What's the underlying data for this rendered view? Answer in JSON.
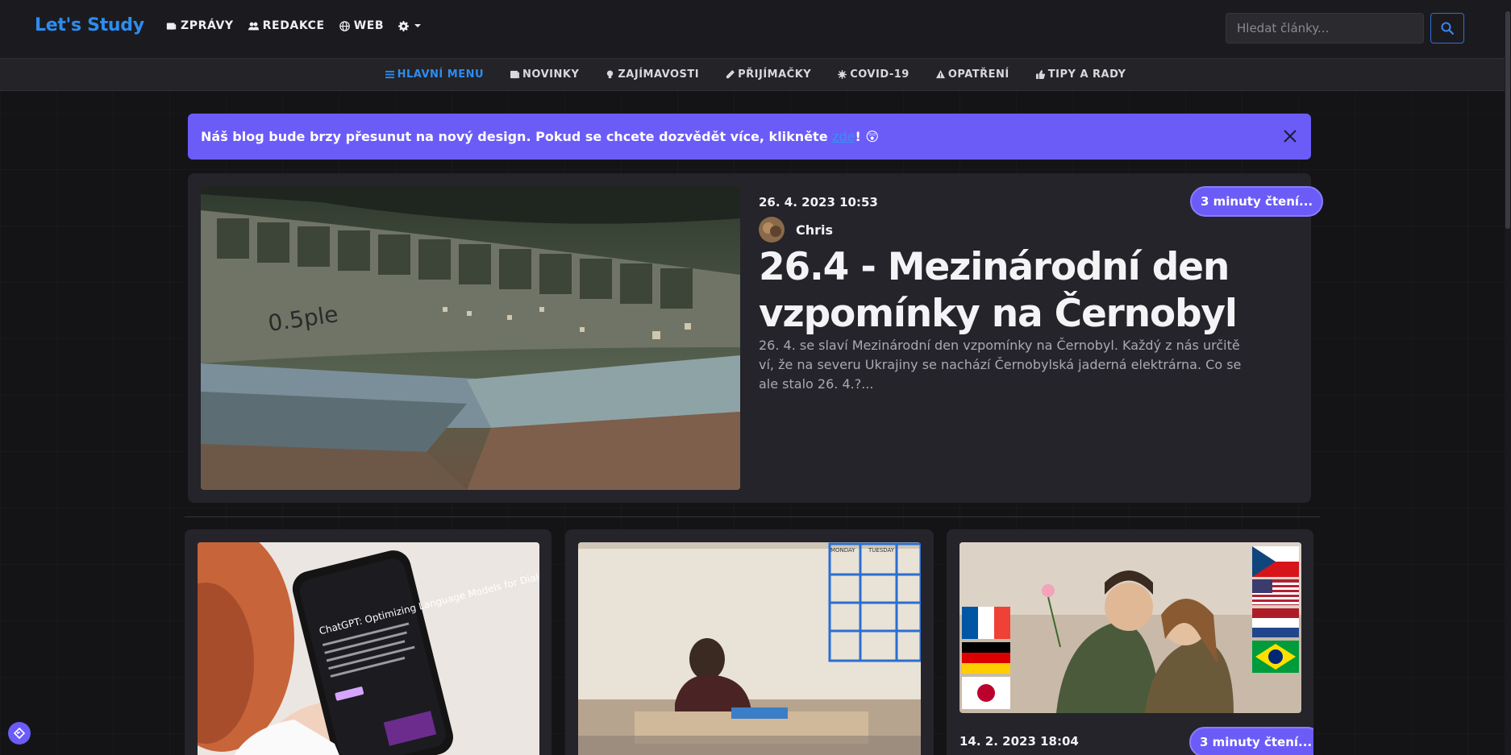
{
  "brand": "Let's Study",
  "topnav": [
    {
      "label": "ZPRÁVY",
      "icon": "newspaper-icon"
    },
    {
      "label": "REDAKCE",
      "icon": "users-icon"
    },
    {
      "label": "WEB",
      "icon": "globe-icon"
    }
  ],
  "settings_icon": "gear-icon",
  "search": {
    "placeholder": "Hledat články..."
  },
  "subnav": [
    {
      "label": "HLAVNÍ MENU",
      "icon": "bars-icon",
      "active": true
    },
    {
      "label": "NOVINKY",
      "icon": "newspaper-icon"
    },
    {
      "label": "ZAJÍMAVOSTI",
      "icon": "lightbulb-icon"
    },
    {
      "label": "PŘIJÍMAČKY",
      "icon": "pencil-icon"
    },
    {
      "label": "COVID-19",
      "icon": "virus-icon"
    },
    {
      "label": "OPATŘENÍ",
      "icon": "warning-icon"
    },
    {
      "label": "TIPY A RADY",
      "icon": "thumbs-up-icon"
    }
  ],
  "alert": {
    "text_before": "Náš blog bude brzy přesunut na nový design. Pokud se chcete dozvědět více, klikněte ",
    "link": "zde",
    "text_after": "! 😲"
  },
  "featured": {
    "date": "26. 4. 2023 10:53",
    "read_time": "3 minuty čtení...",
    "author": "Chris",
    "title": "26.4 - Mezinárodní den vzpomínky na Černobyl",
    "excerpt": "26. 4. se slaví Mezinárodní den vzpomínky na Černobyl. Každý z nás určitě ví, že na severu Ukrajiny se nachází Černobylská jaderná elektrárna. Co se ale stalo 26. 4.?..."
  },
  "cards": [
    {
      "image": "phone-chatgpt-image",
      "phone_text": "ChatGPT: Optimizing Language Models for Dialogue"
    },
    {
      "image": "student-classroom-image",
      "board_days": [
        "MONDAY",
        "TUESDAY"
      ]
    },
    {
      "image": "couple-flags-image",
      "date": "14. 2. 2023 18:04",
      "read_time": "3 minuty čtení..."
    }
  ],
  "colors": {
    "accent": "#2e8cf0",
    "purple": "#6b5cf8",
    "bg": "#141417",
    "card": "#24242a"
  }
}
